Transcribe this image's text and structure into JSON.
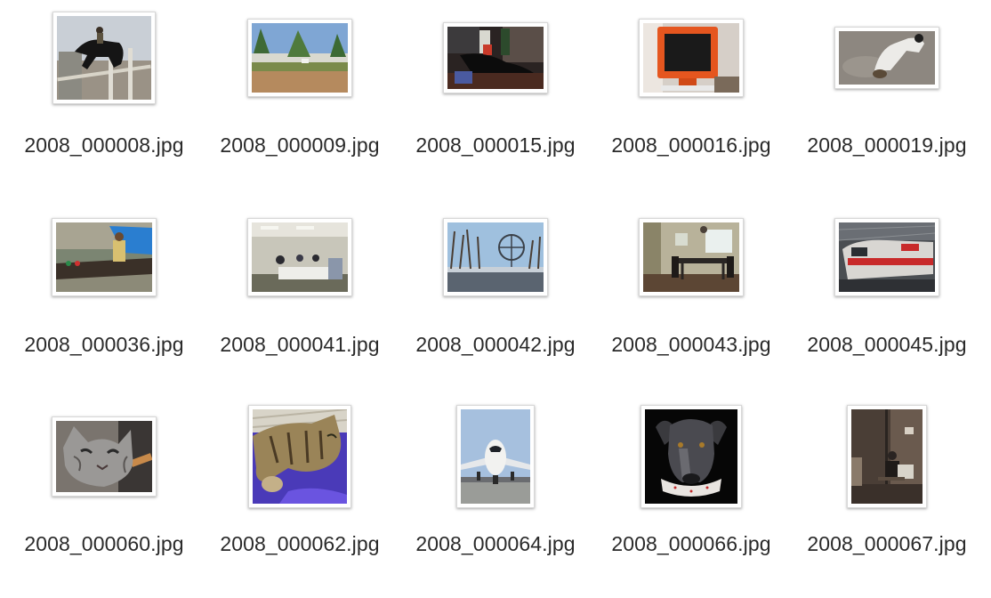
{
  "window": {
    "view": "icon-grid"
  },
  "files": [
    {
      "name": "2008_000008.jpg",
      "thumb": "horse-jump-thumbnail"
    },
    {
      "name": "2008_000009.jpg",
      "thumb": "field-cattle-thumbnail"
    },
    {
      "name": "2008_000015.jpg",
      "thumb": "bottles-table-thumbnail"
    },
    {
      "name": "2008_000016.jpg",
      "thumb": "orange-monitor-thumbnail"
    },
    {
      "name": "2008_000019.jpg",
      "thumb": "dog-sand-thumbnail"
    },
    {
      "name": "2008_000036.jpg",
      "thumb": "boat-woman-thumbnail"
    },
    {
      "name": "2008_000041.jpg",
      "thumb": "meeting-room-thumbnail"
    },
    {
      "name": "2008_000042.jpg",
      "thumb": "ferris-wheel-thumbnail"
    },
    {
      "name": "2008_000043.jpg",
      "thumb": "dining-room-thumbnail"
    },
    {
      "name": "2008_000045.jpg",
      "thumb": "train-station-thumbnail"
    },
    {
      "name": "2008_000060.jpg",
      "thumb": "cat-face-thumbnail"
    },
    {
      "name": "2008_000062.jpg",
      "thumb": "sleeping-cat-thumbnail"
    },
    {
      "name": "2008_000064.jpg",
      "thumb": "airplane-thumbnail"
    },
    {
      "name": "2008_000066.jpg",
      "thumb": "dog-portrait-thumbnail"
    },
    {
      "name": "2008_000067.jpg",
      "thumb": "room-person-thumbnail"
    }
  ]
}
